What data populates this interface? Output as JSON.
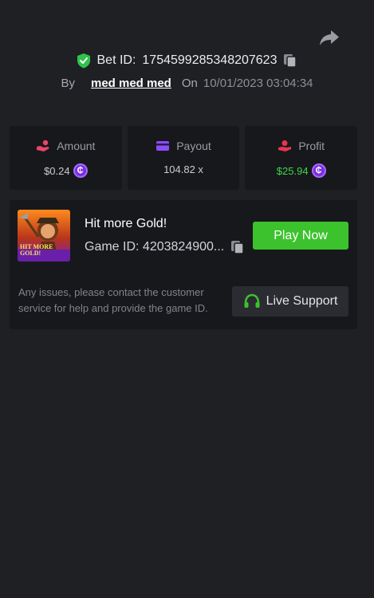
{
  "header": {
    "share_icon": "share-arrow-icon",
    "bet_id_label": "Bet ID:",
    "bet_id": "1754599285348207623",
    "by_label": "By",
    "username": "med med med",
    "on_label": "On",
    "datetime": "10/01/2023 03:04:34"
  },
  "stats": {
    "amount": {
      "label": "Amount",
      "value": "$0.24",
      "icon": "hand-coin-icon",
      "color": "#e8466a"
    },
    "payout": {
      "label": "Payout",
      "value": "104.82 x",
      "icon": "card-icon",
      "color": "#8b4dff"
    },
    "profit": {
      "label": "Profit",
      "value": "$25.94",
      "icon": "hand-money-icon",
      "color": "#e8354e"
    },
    "coin_symbol": "₵"
  },
  "game": {
    "title": "Hit more Gold!",
    "thumb_text": "HIT MORE GOLD!",
    "id_label": "Game ID:",
    "id_value": "4203824900...",
    "play_label": "Play Now"
  },
  "support": {
    "text": "Any issues, please contact the customer service for help and provide the game ID.",
    "button_label": "Live Support"
  },
  "colors": {
    "background": "#1f2024",
    "card": "#17181b",
    "play_button": "#3cc22d",
    "profit_text": "#3fd54a",
    "coin": "#7b2fe0"
  }
}
